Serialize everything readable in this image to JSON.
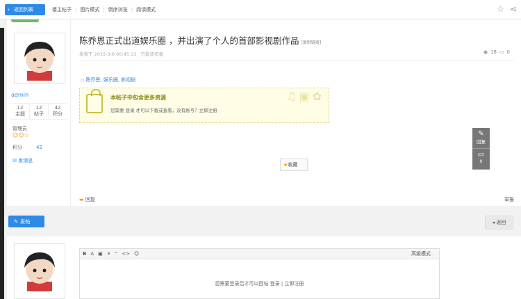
{
  "topbar": {
    "back_label": "返回列表",
    "links": [
      "楼主帖子",
      "图片模式",
      "倒序浏览",
      "阅读模式"
    ]
  },
  "author": {
    "name": "admin",
    "stats": [
      {
        "value": "12",
        "label": "主题"
      },
      {
        "value": "12",
        "label": "帖子"
      },
      {
        "value": "42",
        "label": "积分"
      }
    ],
    "rank": "管理员",
    "credit_label": "积分",
    "credit_value": "42",
    "message_label": "发消息"
  },
  "post": {
    "title": "陈乔恩正式出道娱乐圈 ，并出演了个人的首部影视剧作品",
    "title_tag": "[复制链接]",
    "posted_at": "发表于 2015-3-8 00:45:13",
    "author_only": "只看该作者",
    "views": "18",
    "replies": "0",
    "tags": "陈乔恩, 娱乐圈, 影视剧",
    "hidden_title": "本帖子中包含更多资源",
    "hidden_text": "您需要 登录 才可以下载或查看，没有帐号？立即注册",
    "favorite_label": "收藏",
    "reply_label": "回复",
    "report_label": "举报"
  },
  "float": {
    "reply_label": "回复",
    "comment_count": "0"
  },
  "actions": {
    "post_label": "发帖",
    "return_label": "返回"
  },
  "editor": {
    "advanced_label": "高级模式",
    "login_prompt": "您需要登录后才可以回帖 登录 | 立即注册"
  }
}
